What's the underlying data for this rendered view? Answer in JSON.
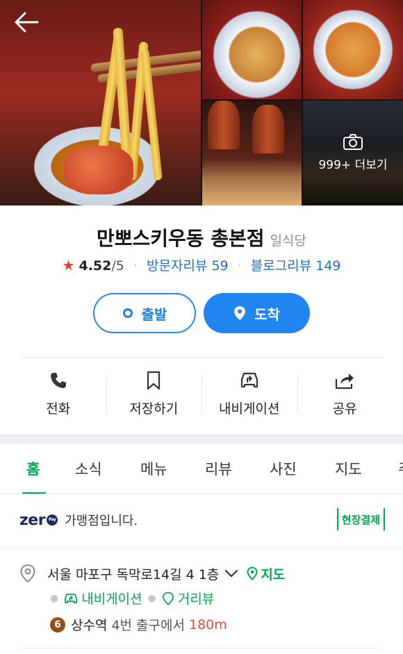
{
  "place": {
    "name": "만뽀스키우동 총본점",
    "category": "일식당",
    "rating": "4.52",
    "rating_max": "/5",
    "visitor_reviews_label": "방문자리뷰",
    "visitor_reviews_count": "59",
    "blog_reviews_label": "블로그리뷰",
    "blog_reviews_count": "149"
  },
  "gallery": {
    "more_label": "999+ 더보기"
  },
  "route_buttons": {
    "start": "출발",
    "arrive": "도착"
  },
  "actions": [
    {
      "label": "전화",
      "icon": "phone-icon"
    },
    {
      "label": "저장하기",
      "icon": "bookmark-icon"
    },
    {
      "label": "내비게이션",
      "icon": "car-navigation-icon"
    },
    {
      "label": "공유",
      "icon": "share-icon"
    }
  ],
  "tabs": [
    {
      "label": "홈",
      "active": true
    },
    {
      "label": "소식"
    },
    {
      "label": "메뉴"
    },
    {
      "label": "리뷰"
    },
    {
      "label": "사진"
    },
    {
      "label": "지도"
    },
    {
      "label": "주"
    }
  ],
  "zero_pay": {
    "logo_text": "zer",
    "pay_text": "Pay",
    "text": "가맹점입니다.",
    "badge": "현장결제"
  },
  "address": {
    "text": "서울 마포구 독막로14길 4 1층",
    "map_link": "지도",
    "navigation_link": "내비게이션",
    "street_view_link": "거리뷰"
  },
  "station": {
    "line": "6",
    "name": "상수역",
    "exit": "4번 출구에서",
    "distance": "180m"
  },
  "colors": {
    "brand_green": "#03a94d",
    "primary_blue": "#1f86ef",
    "review_blue": "#1f6fc8",
    "star_red": "#e63b2e",
    "line6_brown": "#9a4a1a"
  }
}
